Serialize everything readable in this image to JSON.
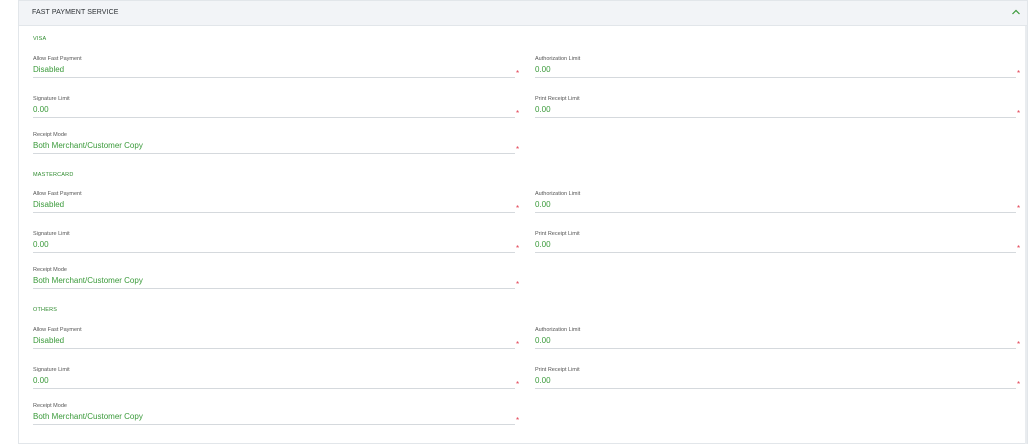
{
  "header": {
    "title": "FAST PAYMENT SERVICE"
  },
  "required_mark": "*",
  "sections": [
    {
      "title": "VISA",
      "fields": {
        "allow_fast_payment": {
          "label": "Allow Fast Payment",
          "value": "Disabled"
        },
        "authorization_limit": {
          "label": "Authorization Limit",
          "value": "0.00"
        },
        "signature_limit": {
          "label": "Signature Limit",
          "value": "0.00"
        },
        "print_receipt_limit": {
          "label": "Print Receipt Limit",
          "value": "0.00"
        },
        "receipt_mode": {
          "label": "Receipt Mode",
          "value": "Both Merchant/Customer Copy"
        }
      }
    },
    {
      "title": "MASTERCARD",
      "fields": {
        "allow_fast_payment": {
          "label": "Allow Fast Payment",
          "value": "Disabled"
        },
        "authorization_limit": {
          "label": "Authorization Limit",
          "value": "0.00"
        },
        "signature_limit": {
          "label": "Signature Limit",
          "value": "0.00"
        },
        "print_receipt_limit": {
          "label": "Print Receipt Limit",
          "value": "0.00"
        },
        "receipt_mode": {
          "label": "Receipt Mode",
          "value": "Both Merchant/Customer Copy"
        }
      }
    },
    {
      "title": "OTHERS",
      "fields": {
        "allow_fast_payment": {
          "label": "Allow Fast Payment",
          "value": "Disabled"
        },
        "authorization_limit": {
          "label": "Authorization Limit",
          "value": "0.00"
        },
        "signature_limit": {
          "label": "Signature Limit",
          "value": "0.00"
        },
        "print_receipt_limit": {
          "label": "Print Receipt Limit",
          "value": "0.00"
        },
        "receipt_mode": {
          "label": "Receipt Mode",
          "value": "Both Merchant/Customer Copy"
        }
      }
    }
  ],
  "colors": {
    "accent_green": "#3a9a3a",
    "required_red": "#e23b4e",
    "header_bg": "#f2f4f7"
  },
  "icons": {
    "collapse": "chevron-up-icon"
  }
}
